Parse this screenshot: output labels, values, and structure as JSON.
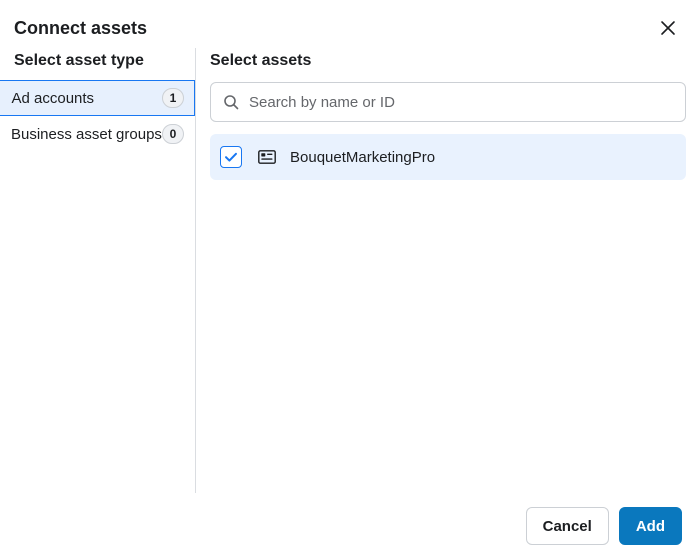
{
  "dialog": {
    "title": "Connect assets"
  },
  "leftPane": {
    "title": "Select asset type",
    "items": [
      {
        "label": "Ad accounts",
        "count": "1",
        "selected": true
      },
      {
        "label": "Business asset groups",
        "count": "0",
        "selected": false
      }
    ]
  },
  "rightPane": {
    "title": "Select assets",
    "search": {
      "placeholder": "Search by name or ID",
      "value": ""
    },
    "assets": [
      {
        "name": "BouquetMarketingPro",
        "checked": true
      }
    ]
  },
  "footer": {
    "cancel": "Cancel",
    "add": "Add"
  }
}
